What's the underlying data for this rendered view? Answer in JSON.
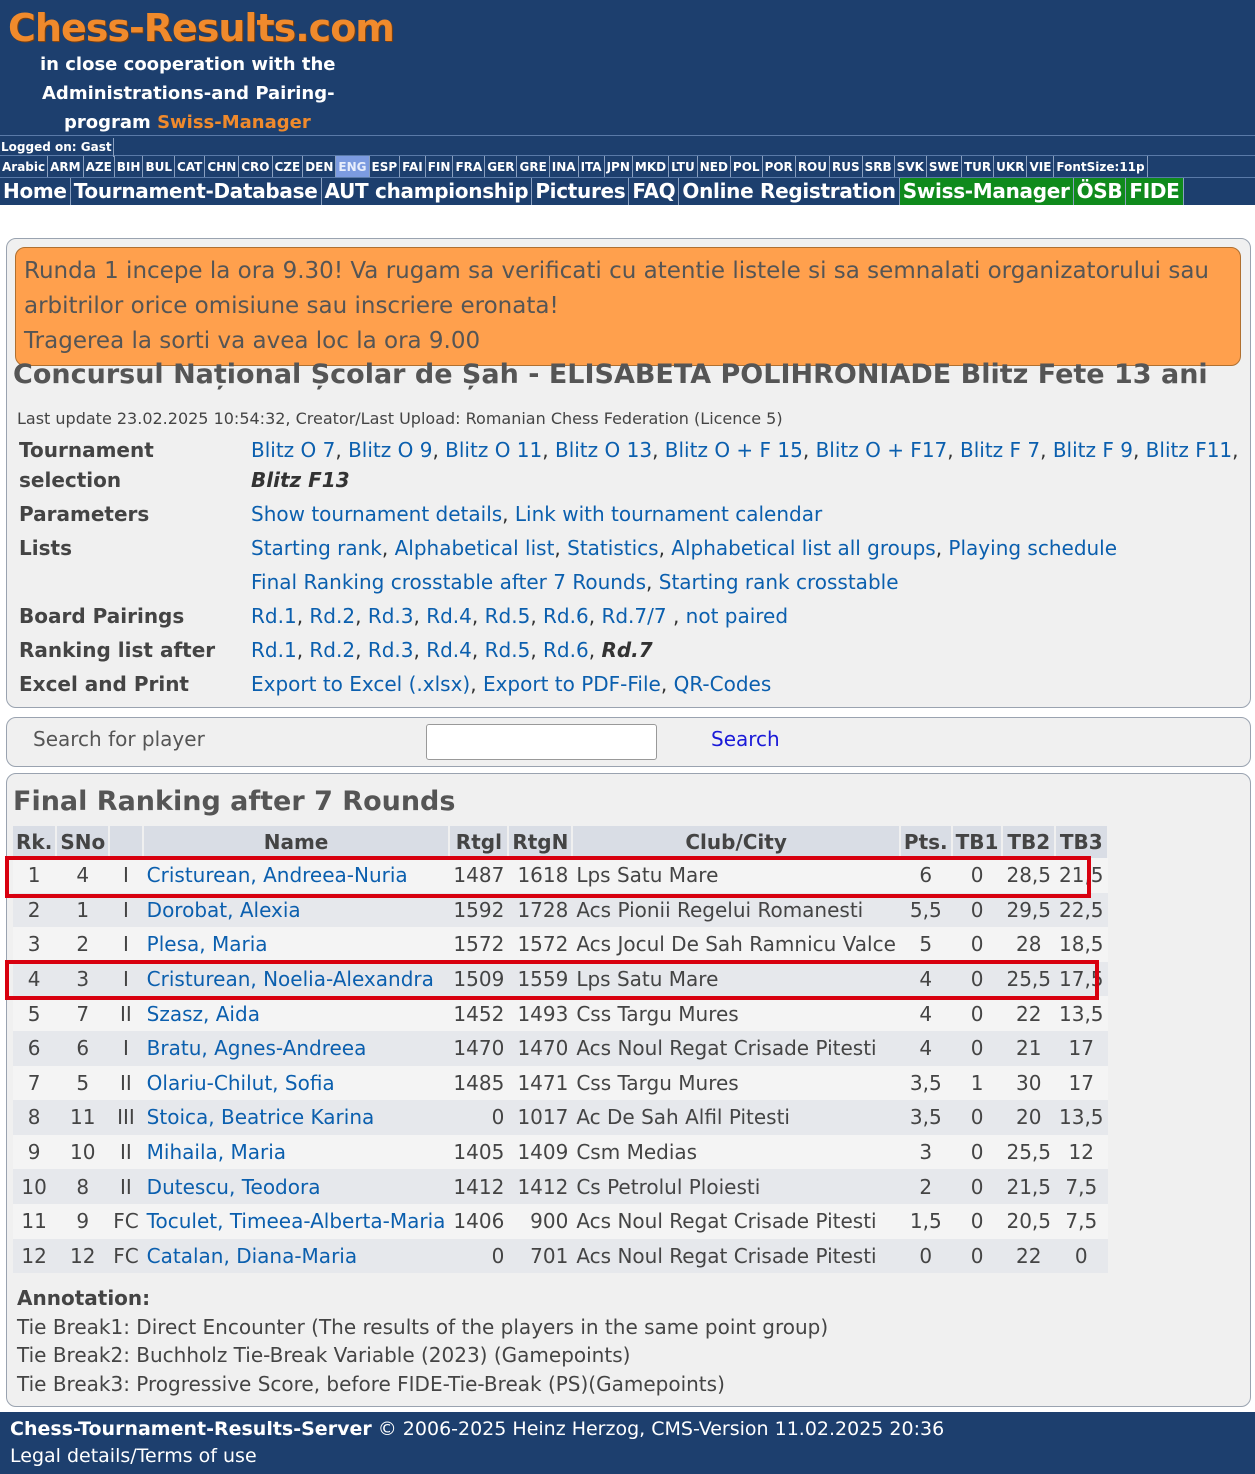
{
  "header": {
    "brand": "Chess-Results.com",
    "sub1": "in close cooperation with the",
    "sub2": "Administrations-and Pairing-",
    "sub3_prefix": "program ",
    "sub3_highlight": "Swiss-Manager"
  },
  "logged_on": "Logged on: Gast",
  "languages": [
    "Arabic",
    "ARM",
    "AZE",
    "BIH",
    "BUL",
    "CAT",
    "CHN",
    "CRO",
    "CZE",
    "DEN",
    "ENG",
    "ESP",
    "FAI",
    "FIN",
    "FRA",
    "GER",
    "GRE",
    "INA",
    "ITA",
    "JPN",
    "MKD",
    "LTU",
    "NED",
    "POL",
    "POR",
    "ROU",
    "RUS",
    "SRB",
    "SVK",
    "SWE",
    "TUR",
    "UKR",
    "VIE",
    "FontSize:11p"
  ],
  "active_language": "ENG",
  "menu": [
    {
      "label": "Home",
      "green": false
    },
    {
      "label": "Tournament-Database",
      "green": false
    },
    {
      "label": "AUT championship",
      "green": false
    },
    {
      "label": "Pictures",
      "green": false
    },
    {
      "label": "FAQ",
      "green": false
    },
    {
      "label": "Online Registration",
      "green": false
    },
    {
      "label": "Swiss-Manager",
      "green": true
    },
    {
      "label": "ÖSB",
      "green": true
    },
    {
      "label": "FIDE",
      "green": true
    }
  ],
  "notice": {
    "line1": "Runda 1 incepe la ora 9.30! Va rugam sa verificati cu atentie listele si sa semnalati organizatorului sau",
    "line2": "arbitrilor orice omisiune sau inscriere eronata!",
    "line3": "Tragerea la sorti va avea loc la ora 9.00"
  },
  "tournament_title": "Concursul Național Școlar de Șah - ELISABETA POLIHRONIADE Blitz Fete 13 ani",
  "last_update": "Last update 23.02.2025 10:54:32, Creator/Last Upload: Romanian Chess Federation (Licence 5)",
  "params": {
    "selection_label": "Tournament selection",
    "selection_links": [
      "Blitz O 7",
      "Blitz O 9",
      "Blitz O 11",
      "Blitz O 13",
      "Blitz O + F 15",
      "Blitz O + F17",
      "Blitz F 7",
      "Blitz F 9",
      "Blitz F11"
    ],
    "selection_current": "Blitz F13",
    "parameters_label": "Parameters",
    "parameters_links": [
      "Show tournament details",
      "Link with tournament calendar"
    ],
    "lists_label": "Lists",
    "lists_links_1": [
      "Starting rank",
      "Alphabetical list",
      "Statistics",
      "Alphabetical list all groups",
      "Playing schedule"
    ],
    "lists_links_2": [
      "Final Ranking crosstable after 7 Rounds",
      "Starting rank crosstable"
    ],
    "pairings_label": "Board Pairings",
    "pairings_links": [
      "Rd.1",
      "Rd.2",
      "Rd.3",
      "Rd.4",
      "Rd.5",
      "Rd.6",
      "Rd.7/7 ",
      "not paired"
    ],
    "ranking_label": "Ranking list after",
    "ranking_links": [
      "Rd.1",
      "Rd.2",
      "Rd.3",
      "Rd.4",
      "Rd.5",
      "Rd.6"
    ],
    "ranking_current": "Rd.7",
    "excel_label": "Excel and Print",
    "excel_links": [
      "Export to Excel (.xlsx)",
      "Export to PDF-File",
      "QR-Codes"
    ]
  },
  "search": {
    "label": "Search for player",
    "button": "Search",
    "value": ""
  },
  "ranking": {
    "heading": "Final Ranking after 7 Rounds",
    "columns": [
      "Rk.",
      "SNo",
      "",
      "Name",
      "Rtgl",
      "RtgN",
      "Club/City",
      "Pts.",
      "TB1",
      "TB2",
      "TB3"
    ],
    "rows": [
      [
        "1",
        "4",
        "I",
        "Cristurean, Andreea-Nuria",
        "1487",
        "1618",
        "Lps Satu Mare",
        "6",
        "0",
        "28,5",
        "21,5"
      ],
      [
        "2",
        "1",
        "I",
        "Dorobat, Alexia",
        "1592",
        "1728",
        "Acs Pionii Regelui Romanesti",
        "5,5",
        "0",
        "29,5",
        "22,5"
      ],
      [
        "3",
        "2",
        "I",
        "Plesa, Maria",
        "1572",
        "1572",
        "Acs Jocul De Sah Ramnicu Valce",
        "5",
        "0",
        "28",
        "18,5"
      ],
      [
        "4",
        "3",
        "I",
        "Cristurean, Noelia-Alexandra",
        "1509",
        "1559",
        "Lps Satu Mare",
        "4",
        "0",
        "25,5",
        "17,5"
      ],
      [
        "5",
        "7",
        "II",
        "Szasz, Aida",
        "1452",
        "1493",
        "Css Targu Mures",
        "4",
        "0",
        "22",
        "13,5"
      ],
      [
        "6",
        "6",
        "I",
        "Bratu, Agnes-Andreea",
        "1470",
        "1470",
        "Acs Noul Regat Crisade Pitesti",
        "4",
        "0",
        "21",
        "17"
      ],
      [
        "7",
        "5",
        "II",
        "Olariu-Chilut, Sofia",
        "1485",
        "1471",
        "Css Targu Mures",
        "3,5",
        "1",
        "30",
        "17"
      ],
      [
        "8",
        "11",
        "III",
        "Stoica, Beatrice Karina",
        "0",
        "1017",
        "Ac De Sah Alfil Pitesti",
        "3,5",
        "0",
        "20",
        "13,5"
      ],
      [
        "9",
        "10",
        "II",
        "Mihaila, Maria",
        "1405",
        "1409",
        "Csm Medias",
        "3",
        "0",
        "25,5",
        "12"
      ],
      [
        "10",
        "8",
        "II",
        "Dutescu, Teodora",
        "1412",
        "1412",
        "Cs Petrolul Ploiesti",
        "2",
        "0",
        "21,5",
        "7,5"
      ],
      [
        "11",
        "9",
        "FC",
        "Toculet, Timeea-Alberta-Maria",
        "1406",
        "900",
        "Acs Noul Regat Crisade Pitesti",
        "1,5",
        "0",
        "20,5",
        "7,5"
      ],
      [
        "12",
        "12",
        "FC",
        "Catalan, Diana-Maria",
        "0",
        "701",
        "Acs Noul Regat Crisade Pitesti",
        "0",
        "0",
        "22",
        "0"
      ]
    ]
  },
  "annotation": {
    "heading": "Annotation:",
    "tb1": "Tie Break1: Direct Encounter (The results of the players in the same point group)",
    "tb2": "Tie Break2: Buchholz Tie-Break Variable (2023) (Gamepoints)",
    "tb3": "Tie Break3: Progressive Score, before FIDE-Tie-Break (PS)(Gamepoints)"
  },
  "footer": {
    "server": "Chess-Tournament-Results-Server",
    "copyright": " © 2006-2025 Heinz Herzog, CMS-Version 11.02.2025 20:36",
    "legal": "Legal details/Terms of use"
  },
  "colors": {
    "header_bg": "#1d3f6e",
    "brand_orange": "#f08a2c",
    "notice_bg": "#ffa04d",
    "link": "#0b5fae",
    "highlight_red": "#d8000f",
    "menu_green": "#0f8a1c"
  }
}
